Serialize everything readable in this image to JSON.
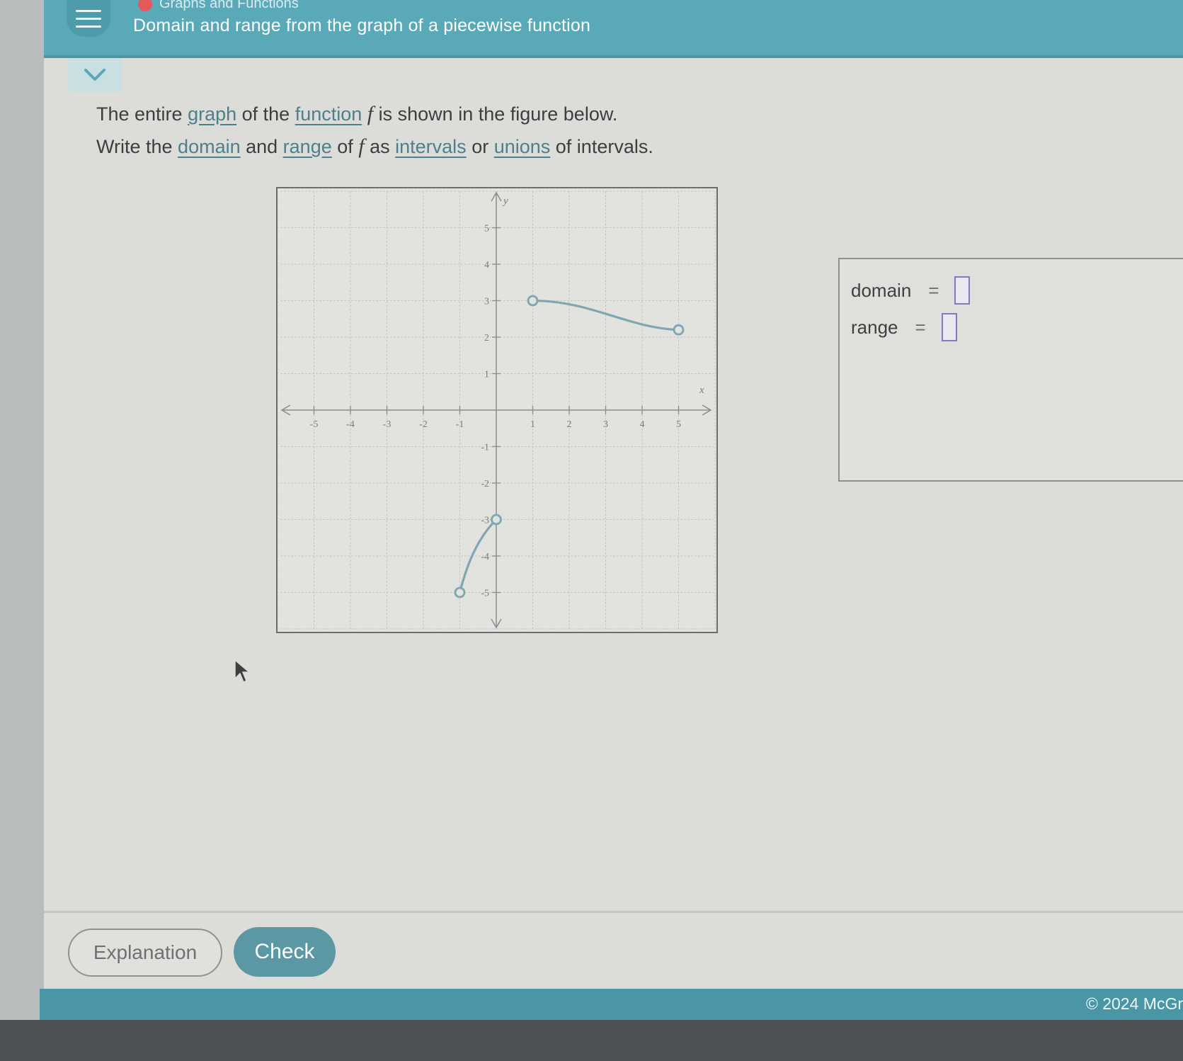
{
  "header": {
    "breadcrumb": "Graphs and Functions",
    "title": "Domain and range from the graph of a piecewise function"
  },
  "question": {
    "line1": {
      "t1": "The entire ",
      "graph": "graph",
      "t2": " of the ",
      "function": "function",
      "fvar": "f",
      "t3": " is shown in the figure below."
    },
    "line2": {
      "t1": "Write the ",
      "domain": "domain",
      "t2": " and ",
      "range": "range",
      "t3": " of ",
      "fvar": "f",
      "t4": " as ",
      "intervals": "intervals",
      "t5": " or ",
      "unions": "unions",
      "t6": " of intervals."
    }
  },
  "graph": {
    "x_axis_label": "x",
    "y_axis_label": "y",
    "x_ticks": [
      "-5",
      "-4",
      "-3",
      "-2",
      "-1",
      "1",
      "2",
      "3",
      "4",
      "5"
    ],
    "y_ticks": [
      "5",
      "4",
      "3",
      "2",
      "1",
      "-1",
      "-2",
      "-3",
      "-4",
      "-5"
    ],
    "pieces": [
      {
        "from": [
          -1,
          -5
        ],
        "to": [
          0,
          -3
        ],
        "start_open": true,
        "end_open": true
      },
      {
        "from": [
          1,
          3
        ],
        "to": [
          5,
          2.2
        ],
        "start_open": true,
        "end_open": true
      }
    ],
    "curve_color": "#7fa7b1"
  },
  "answer": {
    "domain_label": "domain",
    "range_label": "range",
    "equals": "="
  },
  "buttons": {
    "explanation": "Explanation",
    "check": "Check"
  },
  "footer": {
    "copyright": "© 2024 McGr"
  }
}
